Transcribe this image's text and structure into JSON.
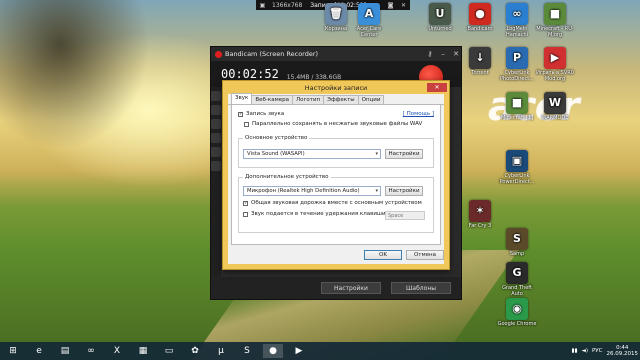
{
  "recording_bar": {
    "resolution": "1366x768",
    "title": "Запись [00:02:52]"
  },
  "desktop_icons": [
    {
      "label": "Корзина",
      "icon": "recycle-bin-icon",
      "color": "#6d89a8",
      "glyph": "🗑"
    },
    {
      "label": "Acer Care Center",
      "icon": "acer-care-icon",
      "color": "#3a8fd8",
      "glyph": "A"
    },
    {
      "label": "Unturned",
      "icon": "unturned-icon",
      "color": "#4a5a4a",
      "glyph": "U"
    },
    {
      "label": "Bandicam",
      "icon": "bandicam-icon",
      "color": "#d02a20",
      "glyph": "●"
    },
    {
      "label": "LogMeIn Hamachi",
      "icon": "hamachi-icon",
      "color": "#2a7fd0",
      "glyph": "∞"
    },
    {
      "label": "Minecraft - RU-M.org",
      "icon": "minecraft-icon",
      "color": "#5a8a3a",
      "glyph": "■"
    },
    {
      "label": "Torrent",
      "icon": "torrent-icon",
      "color": "#3a3a3a",
      "glyph": "↓"
    },
    {
      "label": "CyberLink PhotoDirect...",
      "icon": "photodirector-icon",
      "color": "#2a6ab0",
      "glyph": "P"
    },
    {
      "label": "Играть в SVR0 Mod.org",
      "icon": "play-icon",
      "color": "#d03030",
      "glyph": "▶"
    },
    {
      "label": "Minecraft [1]",
      "icon": "minecraft-alt-icon",
      "color": "#5a8a3a",
      "glyph": "■"
    },
    {
      "label": "WARMODE",
      "icon": "warmode-icon",
      "color": "#3a3a3a",
      "glyph": "W"
    },
    {
      "label": "CyberLink PowerDirect...",
      "icon": "powerdirector-icon",
      "color": "#1a4a7a",
      "glyph": "▣"
    },
    {
      "label": "Far Cry 3",
      "icon": "game-icon",
      "color": "#6a2a2a",
      "glyph": "✶"
    },
    {
      "label": "Samp",
      "icon": "game-icon",
      "color": "#5a4a2a",
      "glyph": "S"
    },
    {
      "label": "Grand Theft Auto",
      "icon": "game-icon",
      "color": "#2a2a2a",
      "glyph": "G"
    },
    {
      "label": "Google Chrome",
      "icon": "chrome-icon",
      "color": "#2a9a4a",
      "glyph": "◉"
    }
  ],
  "bandicam": {
    "title": "Bandicam (Screen Recorder)",
    "timer": "00:02:52",
    "size": "15.4MB / 338.6GB",
    "settings_button": "Настройки",
    "templates_button": "Шаблоны"
  },
  "dialog": {
    "title": "Настройки записи",
    "tabs": [
      "Звук",
      "Веб-камера",
      "Логотип",
      "Эффекты",
      "Опции"
    ],
    "active_tab": "Звук",
    "help_link": "[ Помощь ]",
    "record_sound": {
      "label": "Запись звука",
      "checked": true
    },
    "save_wav": {
      "label": "Параллельно сохранять в несжатые звуковые файлы WAV",
      "checked": false
    },
    "primary_device": {
      "group_label": "Основное устройство",
      "value": "Vista Sound (WASAPI)",
      "settings_label": "Настройки"
    },
    "secondary_device": {
      "group_label": "Дополнительное устройство",
      "value": "Микрофон (Realtek High Definition Audio)",
      "settings_label": "Настройки"
    },
    "shared_track": {
      "label": "Общая звуковая дорожка вместе с основным устройством",
      "checked": true
    },
    "hold_key": {
      "label": "Звук подается в течение удержания клавиши",
      "checked": false,
      "key": "Space"
    },
    "ok_label": "OK",
    "cancel_label": "Отмена"
  },
  "taskbar": {
    "items": [
      {
        "icon": "windows-start-icon",
        "glyph": "⊞"
      },
      {
        "icon": "ie-icon",
        "glyph": "e"
      },
      {
        "icon": "explorer-icon",
        "glyph": "▤"
      },
      {
        "icon": "visual-studio-icon",
        "glyph": "∞"
      },
      {
        "icon": "excel-icon",
        "glyph": "X"
      },
      {
        "icon": "store-icon",
        "glyph": "▦"
      },
      {
        "icon": "files-icon",
        "glyph": "▭"
      },
      {
        "icon": "apps-icon",
        "glyph": "✿"
      },
      {
        "icon": "torrent-icon",
        "glyph": "µ"
      },
      {
        "icon": "skype-icon",
        "glyph": "S"
      },
      {
        "icon": "bandicam-icon",
        "glyph": "●"
      },
      {
        "icon": "media-icon",
        "glyph": "▶"
      }
    ],
    "lang": "РУС",
    "time": "0:44",
    "date": "26.09.2015"
  }
}
